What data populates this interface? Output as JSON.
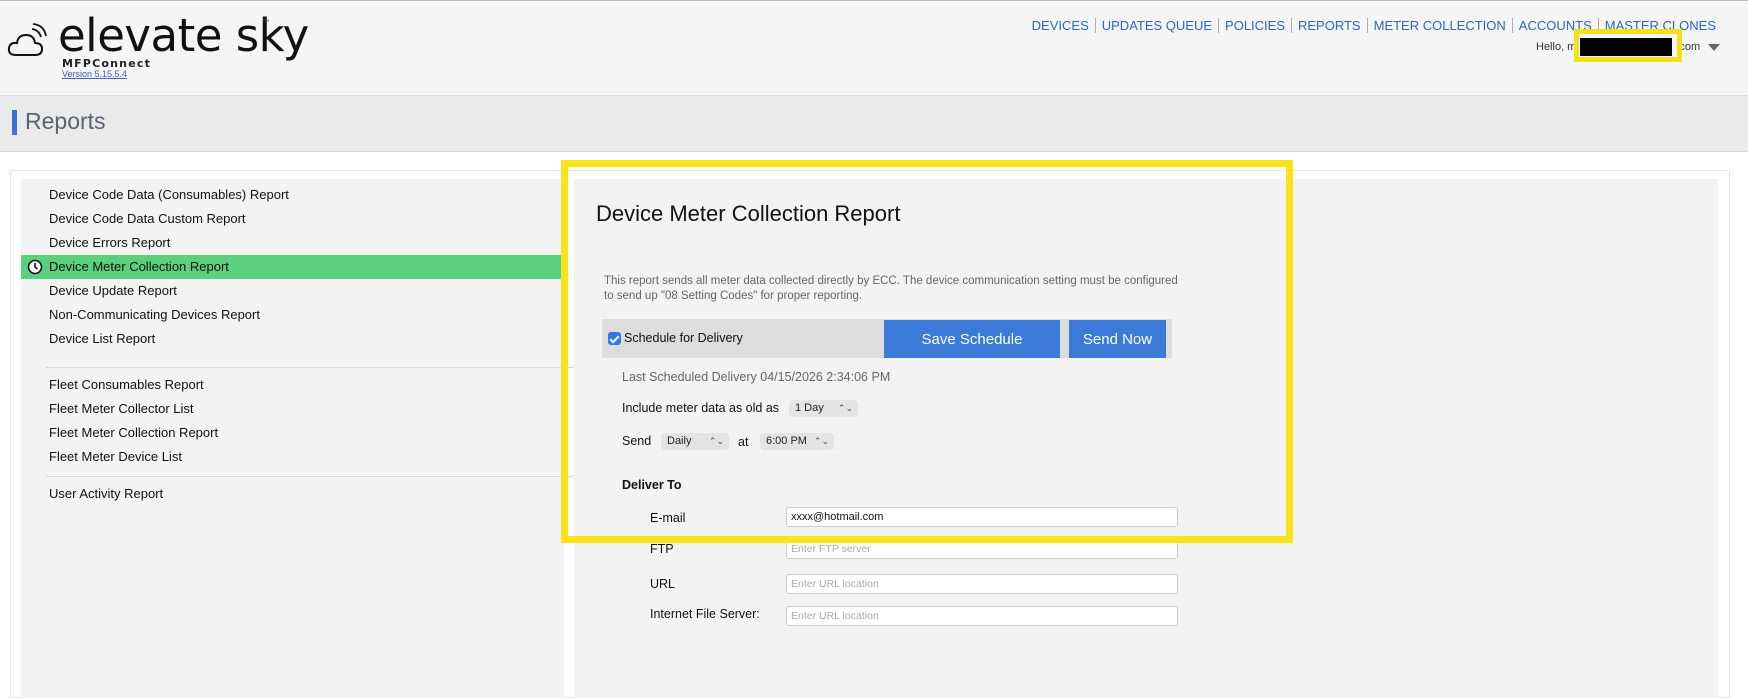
{
  "header": {
    "brand": "elevate sky",
    "trademark": "™",
    "product": "MFPConnect",
    "version": "Version 5.15.5.4",
    "nav": [
      "DEVICES",
      "UPDATES QUEUE",
      "POLICIES",
      "REPORTS",
      "METER COLLECTION",
      "ACCOUNTS",
      "MASTER CLONES"
    ],
    "hello_prefix": "Hello, m",
    "hello_suffix": ".com",
    "icons": [
      "cloud-wifi-icon",
      "chevron-down-icon"
    ]
  },
  "page": {
    "title": "Reports",
    "accent_color": "#3a75d3"
  },
  "sidebar": {
    "groups": [
      [
        "Device Code Data (Consumables) Report",
        "Device Code Data Custom Report",
        "Device Errors Report",
        "Device Meter Collection Report",
        "Device Update Report",
        "Non-Communicating Devices Report",
        "Device List Report"
      ],
      [
        "Fleet Consumables Report",
        "Fleet Meter Collector List",
        "Fleet Meter Collection Report",
        "Fleet Meter Device List"
      ],
      [
        "User Activity Report"
      ]
    ],
    "active_item": "Device Meter Collection Report",
    "active_color": "#5bd180",
    "active_icon": "clock-icon"
  },
  "report": {
    "title": "Device Meter Collection Report",
    "description": "This report sends all meter data collected directly by ECC. The device communication setting must be configured to send up \"08 Setting Codes\" for proper reporting.",
    "schedule_label": "Schedule for Delivery",
    "schedule_checked": true,
    "save_label": "Save Schedule",
    "send_now_label": "Send Now",
    "button_color": "#3b7ad7",
    "last_scheduled": "Last Scheduled Delivery 04/15/2026 2:34:06 PM",
    "include_label": "Include meter data as old as",
    "include_value": "1 Day",
    "send_label": "Send",
    "send_frequency": "Daily",
    "at_label": "at",
    "send_time": "6:00 PM",
    "deliver_to_label": "Deliver To",
    "email_label": "E-mail",
    "email_value": "xxxx@hotmail.com",
    "ftp_label": "FTP",
    "ftp_placeholder": "Enter FTP server",
    "url_label": "URL",
    "url_placeholder": "Enter URL location",
    "ifs_label": "Internet File Server:",
    "ifs_placeholder": "Enter URL location"
  },
  "annotation_color": "#fbe31b"
}
